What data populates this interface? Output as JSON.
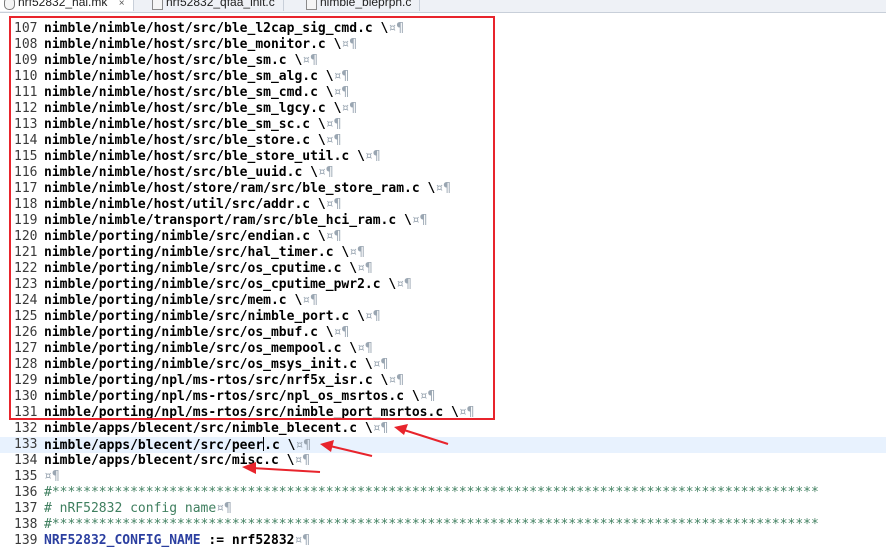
{
  "tabs": [
    {
      "label": "nrf52832_hal.mk",
      "icon": "makefile-icon",
      "active": true
    },
    {
      "label": "nrf52832_qfaa_init.c",
      "icon": "c-file-icon",
      "active": false
    },
    {
      "label": "nimble_bleprph.c",
      "icon": "c-file-icon",
      "active": false
    }
  ],
  "tab_close_glyph": "×",
  "colors": {
    "highlight": "#e8242c",
    "arrow": "#e8242c",
    "current_line": "#e8f2fe",
    "comment": "#3f7f5f",
    "variable": "#2b3fa0"
  },
  "lines": [
    {
      "num": "107",
      "text": "nimble/nimble/host/src/ble_l2cap_sig_cmd.c \\",
      "ws": "¤¶"
    },
    {
      "num": "108",
      "text": "nimble/nimble/host/src/ble_monitor.c \\",
      "ws": "¤¶"
    },
    {
      "num": "109",
      "text": "nimble/nimble/host/src/ble_sm.c \\",
      "ws": "¤¶"
    },
    {
      "num": "110",
      "text": "nimble/nimble/host/src/ble_sm_alg.c \\",
      "ws": "¤¶"
    },
    {
      "num": "111",
      "text": "nimble/nimble/host/src/ble_sm_cmd.c \\",
      "ws": "¤¶"
    },
    {
      "num": "112",
      "text": "nimble/nimble/host/src/ble_sm_lgcy.c \\",
      "ws": "¤¶"
    },
    {
      "num": "113",
      "text": "nimble/nimble/host/src/ble_sm_sc.c \\",
      "ws": "¤¶"
    },
    {
      "num": "114",
      "text": "nimble/nimble/host/src/ble_store.c \\",
      "ws": "¤¶"
    },
    {
      "num": "115",
      "text": "nimble/nimble/host/src/ble_store_util.c \\",
      "ws": "¤¶"
    },
    {
      "num": "116",
      "text": "nimble/nimble/host/src/ble_uuid.c \\",
      "ws": "¤¶"
    },
    {
      "num": "117",
      "text": "nimble/nimble/host/store/ram/src/ble_store_ram.c \\",
      "ws": "¤¶"
    },
    {
      "num": "118",
      "text": "nimble/nimble/host/util/src/addr.c \\",
      "ws": "¤¶"
    },
    {
      "num": "119",
      "text": "nimble/nimble/transport/ram/src/ble_hci_ram.c \\",
      "ws": "¤¶"
    },
    {
      "num": "120",
      "text": "nimble/porting/nimble/src/endian.c \\",
      "ws": "¤¶"
    },
    {
      "num": "121",
      "text": "nimble/porting/nimble/src/hal_timer.c \\",
      "ws": "¤¶"
    },
    {
      "num": "122",
      "text": "nimble/porting/nimble/src/os_cputime.c \\",
      "ws": "¤¶"
    },
    {
      "num": "123",
      "text": "nimble/porting/nimble/src/os_cputime_pwr2.c \\",
      "ws": "¤¶"
    },
    {
      "num": "124",
      "text": "nimble/porting/nimble/src/mem.c \\",
      "ws": "¤¶"
    },
    {
      "num": "125",
      "text": "nimble/porting/nimble/src/nimble_port.c \\",
      "ws": "¤¶"
    },
    {
      "num": "126",
      "text": "nimble/porting/nimble/src/os_mbuf.c \\",
      "ws": "¤¶"
    },
    {
      "num": "127",
      "text": "nimble/porting/nimble/src/os_mempool.c \\",
      "ws": "¤¶"
    },
    {
      "num": "128",
      "text": "nimble/porting/nimble/src/os_msys_init.c \\",
      "ws": "¤¶"
    },
    {
      "num": "129",
      "text": "nimble/porting/npl/ms-rtos/src/nrf5x_isr.c \\",
      "ws": "¤¶"
    },
    {
      "num": "130",
      "text": "nimble/porting/npl/ms-rtos/src/npl_os_msrtos.c \\",
      "ws": "¤¶"
    },
    {
      "num": "131",
      "text": "nimble/porting/npl/ms-rtos/src/nimble_port_msrtos.c \\",
      "ws": "¤¶"
    },
    {
      "num": "132",
      "text": "nimble/apps/blecent/src/nimble_blecent.c \\",
      "ws": "¤¶"
    },
    {
      "num": "133",
      "text_before_caret": "nimble/apps/blecent/src/peer",
      "text": ".c \\",
      "ws": "¤¶",
      "current": true
    },
    {
      "num": "134",
      "text": "nimble/apps/blecent/src/misc.c \\",
      "ws": "¤¶"
    },
    {
      "num": "135",
      "text": "",
      "ws": "¤¶"
    },
    {
      "num": "136",
      "text": "#**************************************************************************************************",
      "ws": "",
      "kind": "comment"
    },
    {
      "num": "137",
      "text": "# nRF52832 config name",
      "ws": "¤¶",
      "kind": "comment"
    },
    {
      "num": "138",
      "text": "#**************************************************************************************************",
      "ws": "",
      "kind": "comment"
    },
    {
      "num": "139",
      "var": "NRF52832_CONFIG_NAME",
      "text": " := nrf52832",
      "ws": "¤¶"
    }
  ]
}
